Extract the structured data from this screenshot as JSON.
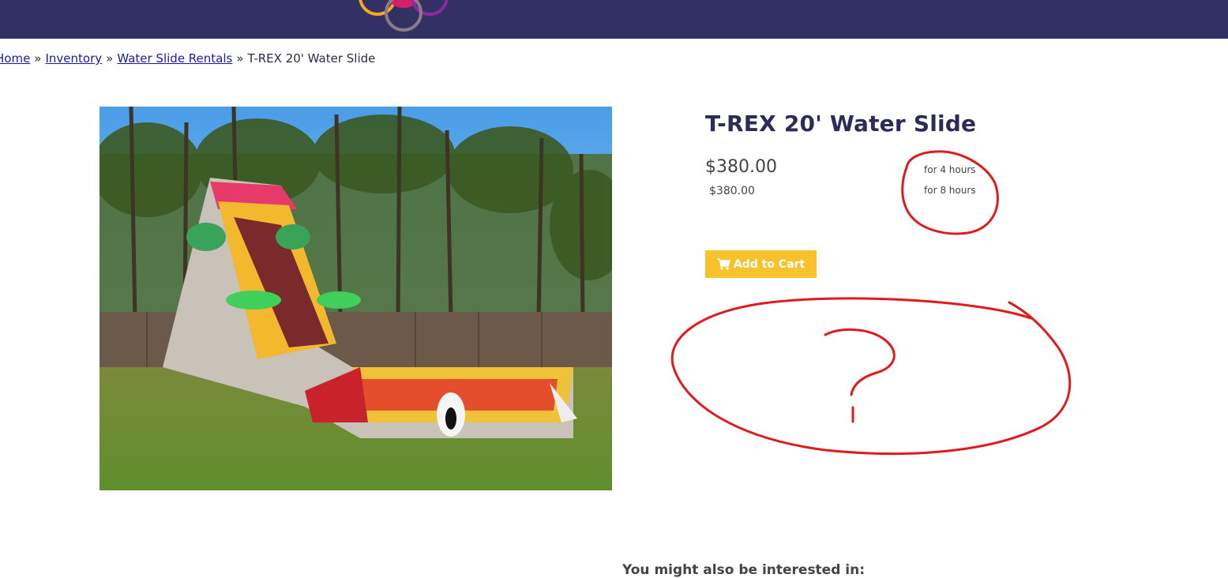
{
  "breadcrumb": {
    "home": "Home",
    "inventory": "Inventory",
    "category": "Water Slide Rentals",
    "current": "T-REX 20' Water Slide",
    "separator": "»"
  },
  "product": {
    "title": "T-REX 20' Water Slide",
    "price_main": "$380.00",
    "price_sub": "$380.00",
    "duration_1": "for 4 hours",
    "duration_2": "for 8 hours"
  },
  "actions": {
    "add_to_cart": "Add to Cart"
  },
  "related": {
    "heading": "You might also be interested in:"
  },
  "annotations": {
    "question_mark": "?"
  },
  "colors": {
    "header": "#333063",
    "button": "#f8c22d",
    "title": "#2d2b5a",
    "annotation": "#e01b1b"
  },
  "icons": {
    "cart": "cart-icon",
    "logo": "logo-rings"
  }
}
